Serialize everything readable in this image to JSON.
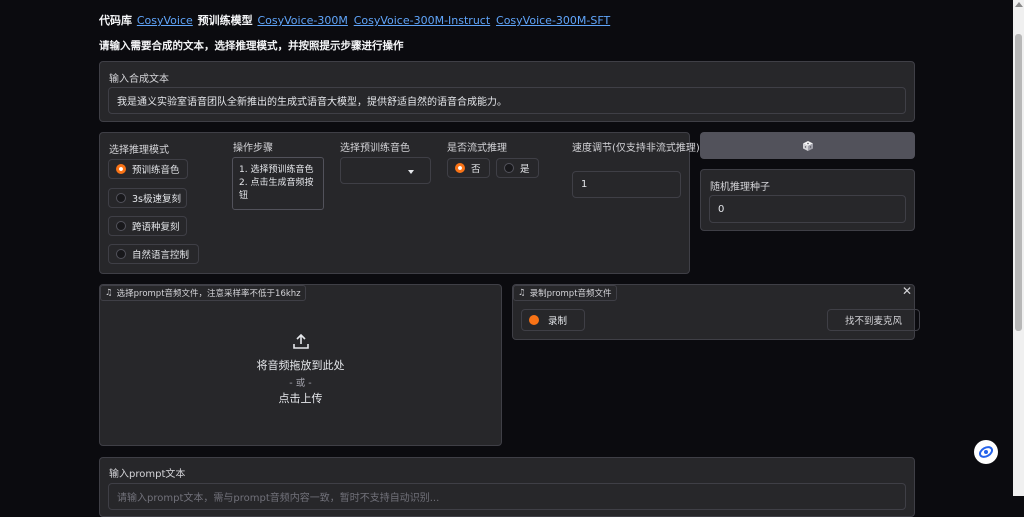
{
  "header": {
    "prefix": "代码库",
    "link1": "CosyVoice",
    "middle": "预训练模型",
    "link2": "CosyVoice-300M",
    "link3": "CosyVoice-300M-Instruct",
    "link4": "CosyVoice-300M-SFT"
  },
  "instructions": "请输入需要合成的文本，选择推理模式，并按照提示步骤进行操作",
  "synth_text": {
    "label": "输入合成文本",
    "value": "我是通义实验室语音团队全新推出的生成式语音大模型，提供舒适自然的语音合成能力。"
  },
  "mode": {
    "label": "选择推理模式",
    "options": [
      "预训练音色",
      "3s极速复刻",
      "跨语种复刻",
      "自然语言控制"
    ],
    "selected": "预训练音色"
  },
  "steps": {
    "label": "操作步骤",
    "line1": "1. 选择预训练音色",
    "line2": "2. 点击生成音频按",
    "line3": "钮"
  },
  "voice": {
    "label": "选择预训练音色",
    "value": ""
  },
  "stream": {
    "label": "是否流式推理",
    "options": [
      "否",
      "是"
    ],
    "selected": "否"
  },
  "speed": {
    "label": "速度调节(仅支持非流式推理)",
    "value": "1"
  },
  "seed": {
    "label": "随机推理种子",
    "value": "0",
    "dice_icon": "dice-icon"
  },
  "upload": {
    "tag": "选择prompt音频文件，注意采样率不低于16khz",
    "drop_text": "将音频拖放到此处",
    "or_text": "- 或 -",
    "click_text": "点击上传"
  },
  "record": {
    "tag": "录制prompt音频文件",
    "record_label": "录制",
    "mic_label": "找不到麦克风"
  },
  "prompt_text": {
    "label": "输入prompt文本",
    "placeholder": "请输入prompt文本，需与prompt音频内容一致，暂时不支持自动识别..."
  },
  "colors": {
    "accent": "#f97316",
    "link": "#60a5fa",
    "panel": "#27272a",
    "background": "#0b0b0f"
  }
}
